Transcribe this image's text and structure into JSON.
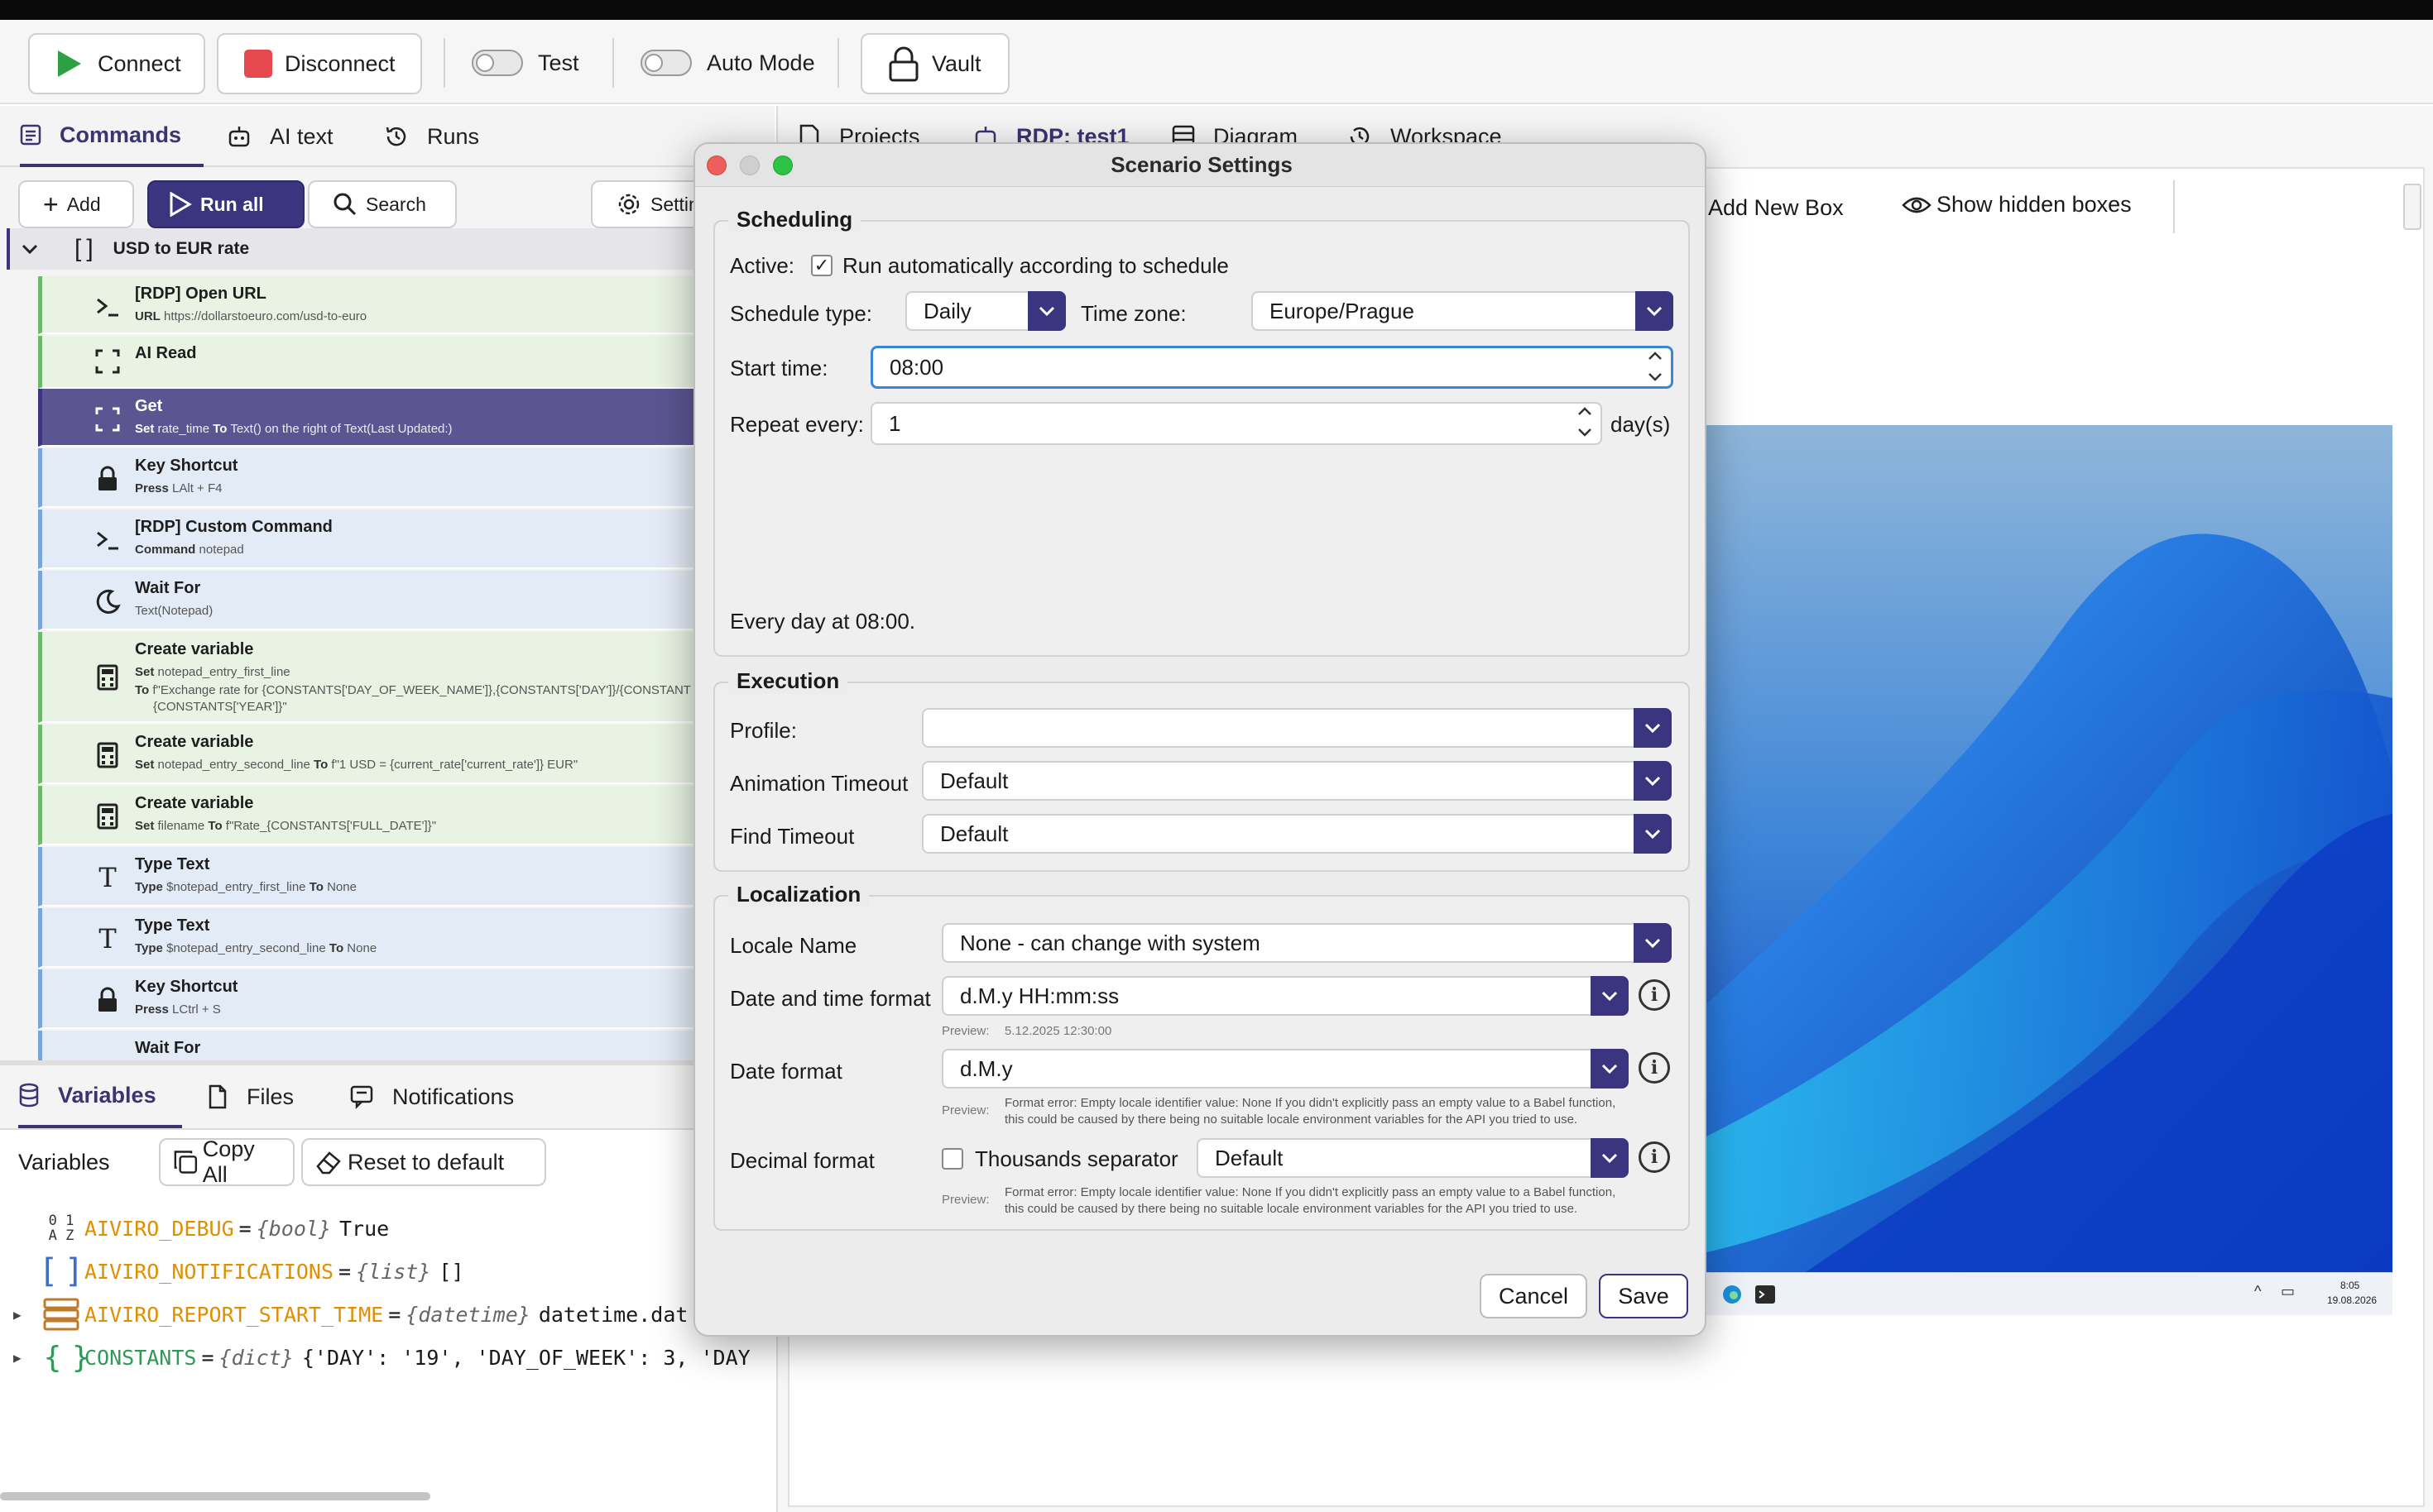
{
  "toolbar": {
    "connect": "Connect",
    "disconnect": "Disconnect",
    "test": "Test",
    "auto_mode": "Auto Mode",
    "vault": "Vault"
  },
  "left_tabs": [
    "Commands",
    "AI text",
    "Runs"
  ],
  "command_bar": {
    "add": "Add",
    "run_all": "Run all",
    "search": "Search",
    "settings": "Settin"
  },
  "group": {
    "name": "USD to EUR rate"
  },
  "commands": [
    {
      "title": "[RDP] Open URL",
      "k1": "URL",
      "v1": "https://dollarstoeuro.com/usd-to-euro",
      "k2": "",
      "v2": "",
      "extra": ""
    },
    {
      "title": "AI Read",
      "k1": "",
      "v1": "",
      "k2": "",
      "v2": "",
      "extra": ""
    },
    {
      "title": "Get",
      "k1": "Set",
      "v1": "rate_time",
      "k2": "To",
      "v2": "Text() on the right of Text(Last Updated:)",
      "extra": ""
    },
    {
      "title": "Key Shortcut",
      "k1": "Press",
      "v1": "LAlt + F4",
      "k2": "",
      "v2": "",
      "extra": ""
    },
    {
      "title": "[RDP] Custom Command",
      "k1": "Command",
      "v1": "notepad",
      "k2": "",
      "v2": "",
      "extra": ""
    },
    {
      "title": "Wait For",
      "k1": "",
      "v1": "Text(Notepad)",
      "k2": "",
      "v2": "",
      "extra": ""
    },
    {
      "title": "Create variable",
      "k1": "Set",
      "v1": "notepad_entry_first_line",
      "k2": "To",
      "v2": "f\"Exchange rate for {CONSTANTS['DAY_OF_WEEK_NAME']},{CONSTANTS['DAY']}/{CONSTANT",
      "extra": "{CONSTANTS['YEAR']}\""
    },
    {
      "title": "Create variable",
      "k1": "Set",
      "v1": "notepad_entry_second_line",
      "k2": "To",
      "v2": "f\"1 USD = {current_rate['current_rate']} EUR\"",
      "extra": ""
    },
    {
      "title": "Create variable",
      "k1": "Set",
      "v1": "filename",
      "k2": "To",
      "v2": "f\"Rate_{CONSTANTS['FULL_DATE']}\"",
      "extra": ""
    },
    {
      "title": "Type Text",
      "k1": "Type",
      "v1": "$notepad_entry_first_line",
      "k2": "To",
      "v2": "None",
      "extra": ""
    },
    {
      "title": "Type Text",
      "k1": "Type",
      "v1": "$notepad_entry_second_line",
      "k2": "To",
      "v2": "None",
      "extra": ""
    },
    {
      "title": "Key Shortcut",
      "k1": "Press",
      "v1": "LCtrl + S",
      "k2": "",
      "v2": "",
      "extra": ""
    },
    {
      "title": "Wait For",
      "k1": "",
      "v1": "",
      "k2": "",
      "v2": "",
      "extra": ""
    }
  ],
  "var_tabs": [
    "Variables",
    "Files",
    "Notifications"
  ],
  "var_toolbar": {
    "label": "Variables",
    "copy_all": "Copy All",
    "reset": "Reset to default"
  },
  "variables": [
    {
      "name": "AIVIRO_DEBUG",
      "type": "{bool}",
      "value": "True"
    },
    {
      "name": "AIVIRO_NOTIFICATIONS",
      "type": "{list}",
      "value": "[]"
    },
    {
      "name": "AIVIRO_REPORT_START_TIME",
      "type": "{datetime}",
      "value": "datetime.dat"
    },
    {
      "name": "CONSTANTS",
      "type": "{dict}",
      "value": "{'DAY': '19', 'DAY_OF_WEEK': 3, 'DAY"
    }
  ],
  "right_tabs": [
    "Projects",
    "RDP: test1",
    "Diagram",
    "Workspace"
  ],
  "right_toolbar": {
    "add_box": "Add New Box",
    "show_hidden": "Show hidden boxes"
  },
  "taskbar": {
    "time": "8:05",
    "date": "19.08.2026"
  },
  "dialog": {
    "title": "Scenario Settings",
    "scheduling": {
      "legend": "Scheduling",
      "active_label": "Active:",
      "active_text": "Run automatically according to schedule",
      "schedule_type_label": "Schedule type:",
      "schedule_type": "Daily",
      "time_zone_label": "Time zone:",
      "time_zone": "Europe/Prague",
      "start_time_label": "Start time:",
      "start_time": "08:00",
      "repeat_label": "Repeat every:",
      "repeat_value": "1",
      "repeat_unit": "day(s)",
      "summary": "Every day at 08:00."
    },
    "execution": {
      "legend": "Execution",
      "profile_label": "Profile:",
      "profile": "",
      "anim_label": "Animation Timeout",
      "anim": "Default",
      "find_label": "Find Timeout",
      "find": "Default"
    },
    "localization": {
      "legend": "Localization",
      "locale_label": "Locale Name",
      "locale": "None - can change with system",
      "dt_label": "Date and time format",
      "dt_value": "d.M.y HH:mm:ss",
      "preview_label": "Preview:",
      "dt_preview": "5.12.2025 12:30:00",
      "d_label": "Date format",
      "d_value": "d.M.y",
      "err_line1": "Format error: Empty locale identifier value: None If you didn't explicitly pass an empty value to a Babel function,",
      "err_line2": "this could be caused by there being no suitable locale environment variables for the API you tried to use.",
      "dec_label": "Decimal format",
      "thousands": "Thousands separator",
      "dec_value": "Default"
    },
    "cancel": "Cancel",
    "save": "Save"
  }
}
